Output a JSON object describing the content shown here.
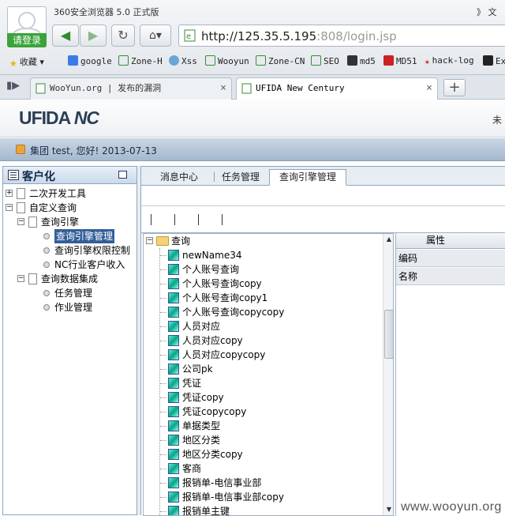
{
  "browser": {
    "brand": "360安全浏览器 5.0 正式版",
    "login_label": "请登录",
    "menu_more": "》 文",
    "url_host": "http://125.35.5.195",
    "url_rest": ":808/login.jsp",
    "bookmarks": [
      "收藏",
      "google",
      "Zone-H",
      "Xss",
      "Wooyun",
      "Zone-CN",
      "SEO",
      "md5",
      "MD51",
      "hack-log",
      "Ex"
    ],
    "tabs": [
      {
        "label": "WooYun.org | 发布的漏洞"
      },
      {
        "label": "UFIDA New Century"
      }
    ],
    "new_tab": "+",
    "close": "×"
  },
  "app": {
    "logo_text": "UFIDA",
    "logo_nc": "NC",
    "header_right": "未",
    "user_text": "集团 test, 您好! 2013-07-13",
    "left_title": "客户化",
    "left_tree": [
      {
        "label": "二次开发工具",
        "level": 0,
        "expander": "+"
      },
      {
        "label": "自定义查询",
        "level": 0,
        "expander": "-"
      },
      {
        "label": "查询引擎",
        "level": 1,
        "expander": "-"
      },
      {
        "label": "查询引擎管理",
        "level": 2,
        "selected": true
      },
      {
        "label": "查询引擎权限控制",
        "level": 2
      },
      {
        "label": "NC行业客户收入",
        "level": 2
      },
      {
        "label": "查询数据集成",
        "level": 1,
        "expander": "-"
      },
      {
        "label": "任务管理",
        "level": 2
      },
      {
        "label": "作业管理",
        "level": 2
      }
    ],
    "tabs": [
      "消息中心",
      "任务管理",
      "查询引擎管理"
    ],
    "query_root": "查询",
    "query_items": [
      "newName34",
      "个人账号查询",
      "个人账号查询copy",
      "个人账号查询copy1",
      "个人账号查询copycopy",
      "人员对应",
      "人员对应copy",
      "人员对应copycopy",
      "公司pk",
      "凭证",
      "凭证copy",
      "凭证copycopy",
      "单据类型",
      "地区分类",
      "地区分类copy",
      "客商",
      "报销单-电信事业部",
      "报销单-电信事业部copy",
      "报销单主键"
    ],
    "prop_header": "属性",
    "prop_rows": [
      "编码",
      "名称"
    ]
  },
  "watermark": "www.wooyun.org",
  "colors": {
    "selected": "#335e9a",
    "login_green": "#3aa33a",
    "logo_red": "#e33"
  }
}
